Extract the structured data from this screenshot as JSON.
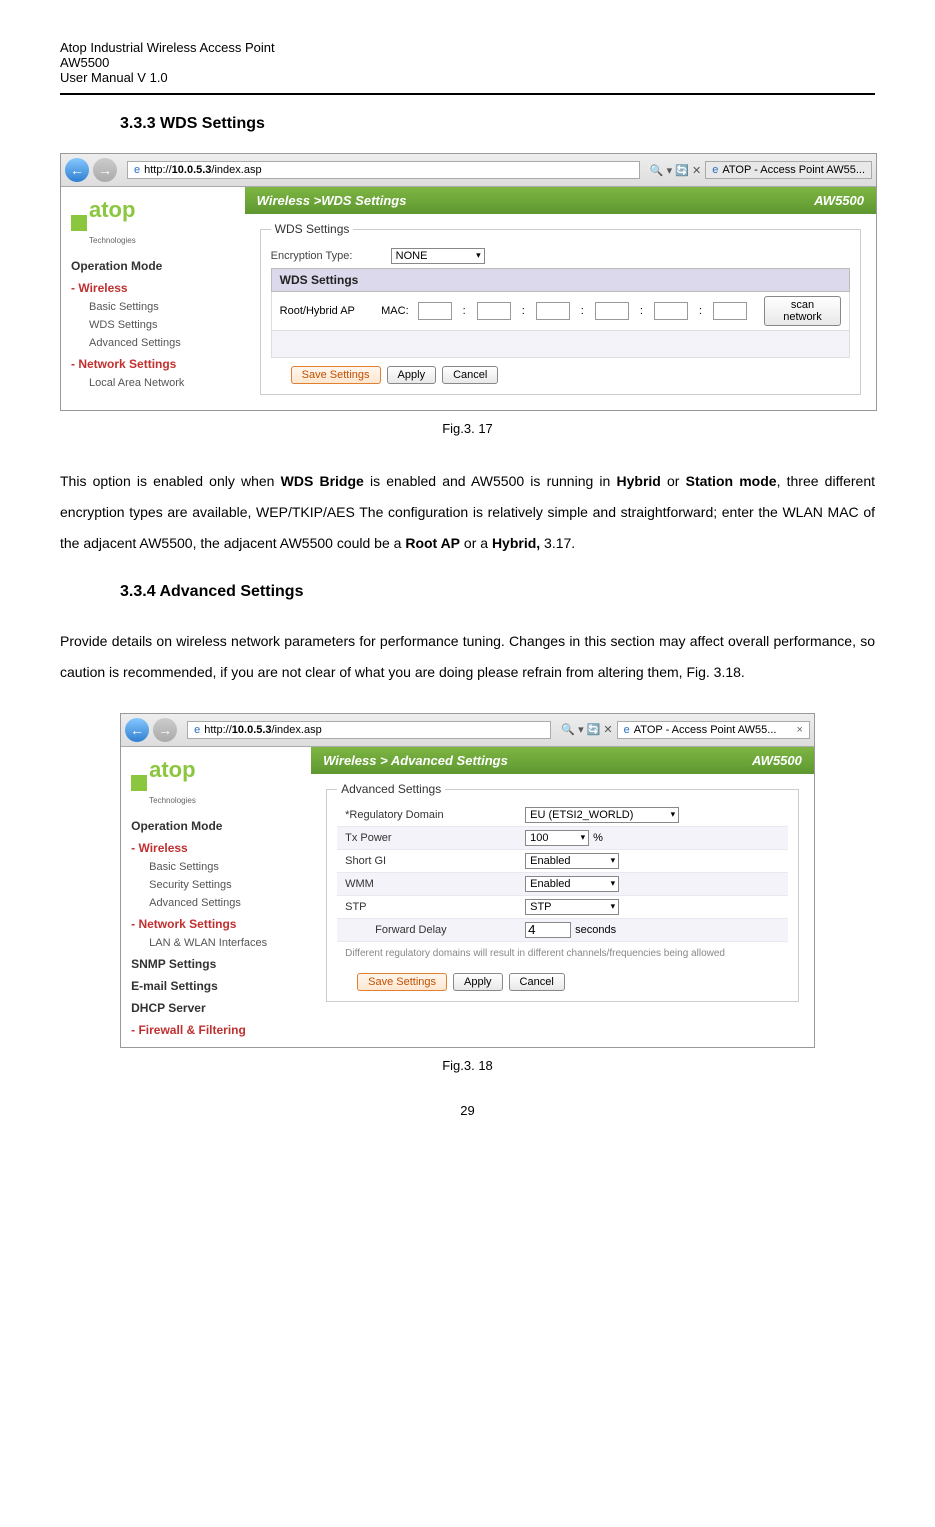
{
  "header": {
    "line1": "Atop Industrial Wireless Access Point",
    "line2": "AW5500",
    "line3": "User Manual V 1.0"
  },
  "section1": {
    "title": "3.3.3 WDS Settings",
    "browser": {
      "url": "http://10.0.5.3/index.asp",
      "url_host": "10.0.5.3",
      "refresh": "↻ ✕",
      "search_hint": "🔍 ▾",
      "tab": "ATOP - Access Point AW55..."
    },
    "logo": "atop",
    "logo_sub": "Technologies",
    "nav": {
      "op_mode": "Operation Mode",
      "wireless": "Wireless",
      "basic": "Basic Settings",
      "wds": "WDS Settings",
      "adv": "Advanced Settings",
      "net": "Network Settings",
      "lan": "Local Area Network"
    },
    "breadcrumb": "Wireless >WDS Settings",
    "model": "AW5500",
    "fieldset_title": "WDS Settings",
    "enc_label": "Encryption Type:",
    "enc_value": "NONE",
    "table_title": "WDS Settings",
    "root_label": "Root/Hybrid AP",
    "mac_label": "MAC:",
    "scan_btn": "scan network",
    "btn_save": "Save Settings",
    "btn_apply": "Apply",
    "btn_cancel": "Cancel",
    "fig": "Fig.3. 17"
  },
  "para1": {
    "t1": "This option is enabled only when ",
    "b1": "WDS Bridge",
    "t2": " is enabled and AW5500 is running in ",
    "b2": "Hybrid",
    "t3": " or ",
    "b3": "Station mode",
    "t4": ", three different encryption types are available, WEP/TKIP/AES The configuration is relatively simple and straightforward; enter the WLAN MAC of the adjacent AW5500, the adjacent AW5500 could be a ",
    "b4": "Root AP",
    "t5": " or a ",
    "b5": "Hybrid,",
    "t6": " 3.17."
  },
  "section2": {
    "title": "3.3.4 Advanced Settings",
    "intro": "Provide details on wireless network parameters for performance tuning. Changes in this section may affect overall performance, so caution is recommended, if you are not clear of what you are doing please refrain from altering them, Fig. 3.18.",
    "browser": {
      "url": "http://10.0.5.3/index.asp",
      "url_host": "10.0.5.3",
      "tab": "ATOP - Access Point AW55..."
    },
    "nav": {
      "op_mode": "Operation Mode",
      "wireless": "Wireless",
      "basic": "Basic Settings",
      "security": "Security Settings",
      "adv": "Advanced Settings",
      "net": "Network Settings",
      "lan": "LAN & WLAN Interfaces",
      "snmp": "SNMP Settings",
      "email": "E-mail Settings",
      "dhcp": "DHCP Server",
      "fw": "Firewall & Filtering"
    },
    "breadcrumb": "Wireless > Advanced Settings",
    "model": "AW5500",
    "fieldset_title": "Advanced Settings",
    "rows": {
      "reg_label": "*Regulatory Domain",
      "reg_val": "EU (ETSI2_WORLD)",
      "tx_label": "Tx Power",
      "tx_val": "100",
      "tx_unit": "%",
      "gi_label": "Short GI",
      "gi_val": "Enabled",
      "wmm_label": "WMM",
      "wmm_val": "Enabled",
      "stp_label": "STP",
      "stp_val": "STP",
      "fd_label": "Forward Delay",
      "fd_val": "4",
      "fd_unit": "seconds"
    },
    "note": "Different regulatory domains will result in different channels/frequencies being allowed",
    "btn_save": "Save Settings",
    "btn_apply": "Apply",
    "btn_cancel": "Cancel",
    "fig": "Fig.3. 18"
  },
  "page": "29"
}
